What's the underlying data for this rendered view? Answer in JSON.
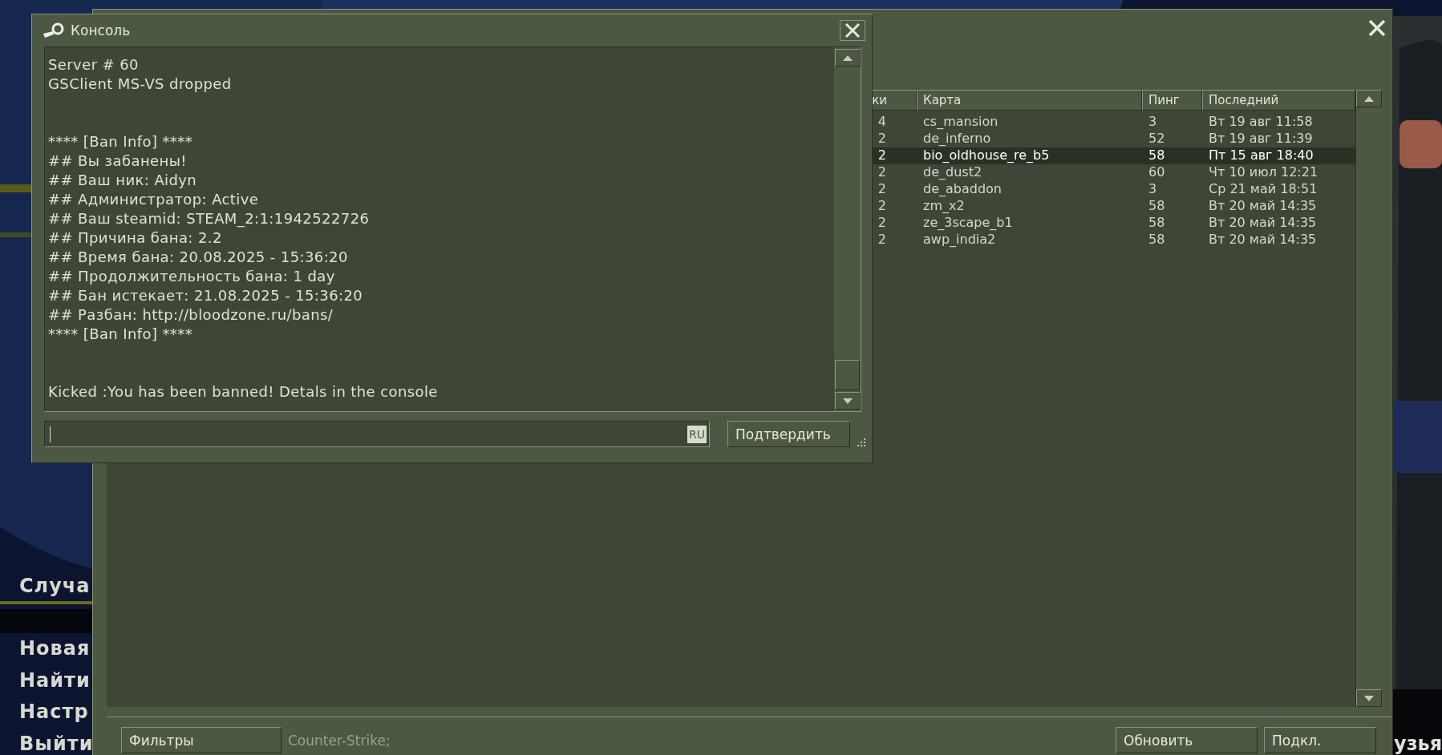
{
  "main_menu": {
    "top_item": "Случа",
    "items": [
      "Новая",
      "Найти",
      "Настр",
      "Выйти"
    ],
    "side_text": "узья"
  },
  "server_browser": {
    "columns": [
      "ки",
      "Карта",
      "Пинг",
      "Последний"
    ],
    "rows": [
      {
        "cells": [
          "4",
          "cs_mansion",
          "3",
          "Вт 19 авг 11:58"
        ],
        "selected": false
      },
      {
        "cells": [
          "2",
          "de_inferno",
          "52",
          "Вт 19 авг 11:39"
        ],
        "selected": false
      },
      {
        "cells": [
          "2",
          "bio_oldhouse_re_b5",
          "58",
          "Пт 15 авг 18:40"
        ],
        "selected": true
      },
      {
        "cells": [
          "2",
          "de_dust2",
          "60",
          "Чт 10 июл 12:21"
        ],
        "selected": false
      },
      {
        "cells": [
          "2",
          "de_abaddon",
          "3",
          "Ср 21 май 18:51"
        ],
        "selected": false
      },
      {
        "cells": [
          "2",
          "zm_x2",
          "58",
          "Вт 20 май 14:35"
        ],
        "selected": false
      },
      {
        "cells": [
          "2",
          "ze_3scape_b1",
          "58",
          "Вт 20 май 14:35"
        ],
        "selected": false
      },
      {
        "cells": [
          "2",
          "awp_india2",
          "58",
          "Вт 20 май 14:35"
        ],
        "selected": false
      }
    ],
    "filter_button": "Фильтры",
    "filter_text": "Counter-Strike;",
    "refresh_button": "Обновить",
    "connect_button": "Подкл."
  },
  "console": {
    "title": "Консоль",
    "blocks": [
      [
        "Server # 60",
        "GSClient MS-VS dropped"
      ],
      [
        "**** [Ban Info] ****",
        "## Вы забанены!",
        "## Ваш ник: Aidyn",
        "## Администратор: Active",
        "## Ваш steamid: STEAM_2:1:1942522726",
        "## Причина бана: 2.2",
        "## Время бана: 20.08.2025 - 15:36:20",
        "## Продолжительность бана: 1 day",
        "## Бан истекает: 21.08.2025 - 15:36:20",
        "## Разбан: http://bloodzone.ru/bans/",
        "**** [Ban Info] ****"
      ],
      [
        "Kicked :You has been banned! Detals in the console"
      ]
    ],
    "input_lang": "RU",
    "submit_button": "Подтвердить"
  }
}
